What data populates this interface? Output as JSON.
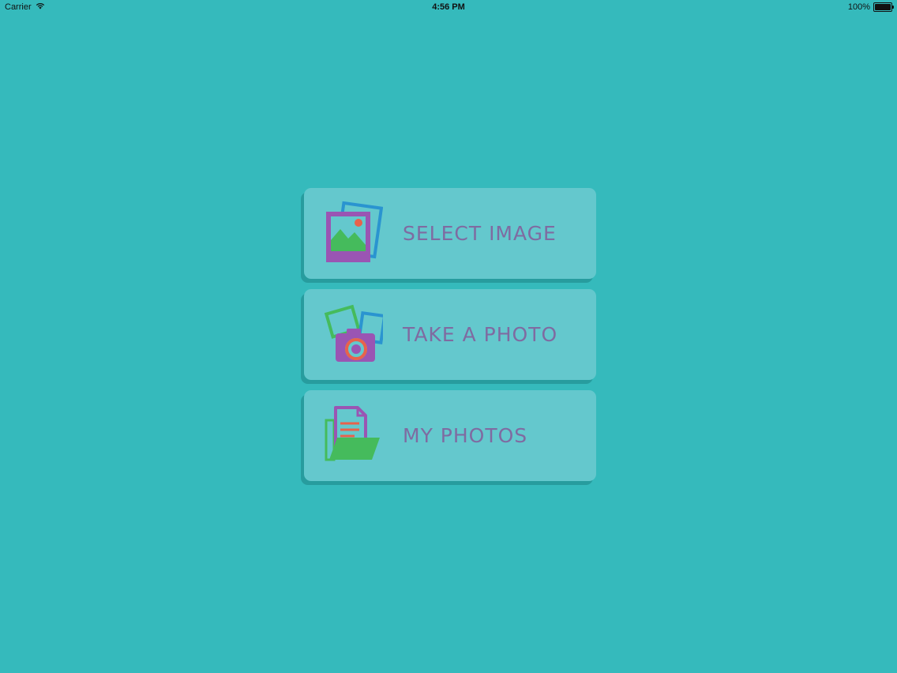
{
  "status_bar": {
    "carrier": "Carrier",
    "time": "4:56 PM",
    "battery_percent_text": "100%",
    "battery_level": 1.0
  },
  "menu": {
    "items": [
      {
        "label": "SELECT IMAGE",
        "icon": "photo-gallery-icon"
      },
      {
        "label": "TAKE A PHOTO",
        "icon": "camera-icon"
      },
      {
        "label": "MY PHOTOS",
        "icon": "folder-document-icon"
      }
    ]
  },
  "colors": {
    "background": "#35BABC",
    "button_face": "#64C8CD",
    "button_shadow": "#279C9E",
    "label_text": "#7F6BA1",
    "icon_purple": "#9A55B3",
    "icon_green": "#45BB5C",
    "icon_blue": "#2A94D0",
    "icon_red": "#E8624B"
  }
}
